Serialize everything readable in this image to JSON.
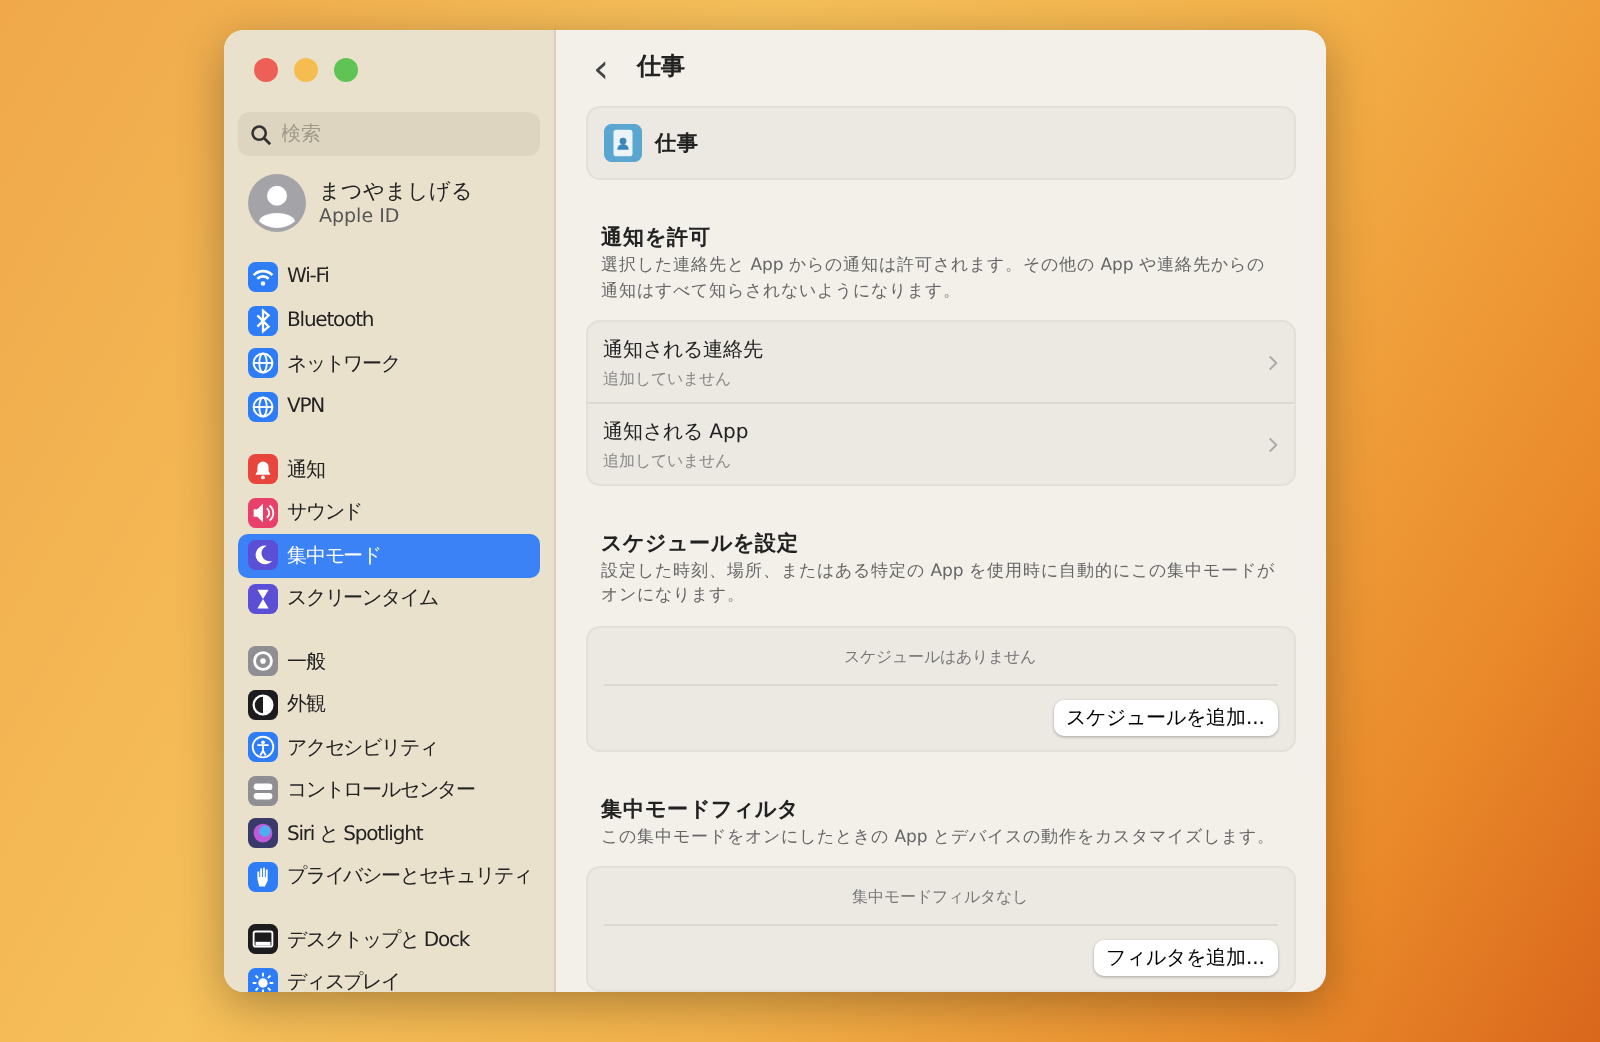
{
  "sidebar": {
    "search": {
      "placeholder": "検索"
    },
    "account": {
      "name": "まつやましげる",
      "subtitle": "Apple ID"
    },
    "groups": [
      [
        {
          "label": "Wi-Fi",
          "kind": "wifi",
          "color": "#2f7df6",
          "selected": false
        },
        {
          "label": "Bluetooth",
          "kind": "bluetooth",
          "color": "#2f7df6",
          "selected": false
        },
        {
          "label": "ネットワーク",
          "kind": "globe",
          "color": "#2f7df6",
          "selected": false
        },
        {
          "label": "VPN",
          "kind": "globe",
          "color": "#2f7df6",
          "selected": false
        }
      ],
      [
        {
          "label": "通知",
          "kind": "bell",
          "color": "#e8453c",
          "selected": false
        },
        {
          "label": "サウンド",
          "kind": "speaker",
          "color": "#e8406a",
          "selected": false
        },
        {
          "label": "集中モード",
          "kind": "moon",
          "color": "#5b4fd6",
          "selected": true
        },
        {
          "label": "スクリーンタイム",
          "kind": "hourglass",
          "color": "#5b4fd6",
          "selected": false
        }
      ],
      [
        {
          "label": "一般",
          "kind": "gear",
          "color": "#8e8e93",
          "selected": false
        },
        {
          "label": "外観",
          "kind": "contrast",
          "color": "#1c1c1e",
          "selected": false
        },
        {
          "label": "アクセシビリティ",
          "kind": "person",
          "color": "#2f7df6",
          "selected": false
        },
        {
          "label": "コントロールセンター",
          "kind": "toggles",
          "color": "#8e8e93",
          "selected": false
        },
        {
          "label": "Siri と Spotlight",
          "kind": "orb",
          "color": "#3a3a6a",
          "selected": false
        },
        {
          "label": "プライバシーとセキュリティ",
          "kind": "hand",
          "color": "#2f7df6",
          "selected": false
        }
      ],
      [
        {
          "label": "デスクトップと Dock",
          "kind": "dock",
          "color": "#1c1c1e",
          "selected": false
        },
        {
          "label": "ディスプレイ",
          "kind": "sun",
          "color": "#2f7df6",
          "selected": false
        }
      ]
    ]
  },
  "header": {
    "back": "‹",
    "title": "仕事"
  },
  "focus_card": {
    "name": "仕事"
  },
  "notifications": {
    "title": "通知を許可",
    "description": "選択した連絡先と App からの通知は許可されます。その他の App や連絡先からの通知はすべて知らされないようになります。",
    "rows": [
      {
        "title": "通知される連絡先",
        "subtitle": "追加していません"
      },
      {
        "title": "通知される App",
        "subtitle": "追加していません"
      }
    ]
  },
  "sections": [
    {
      "title": "スケジュールを設定",
      "description": "設定した時刻、場所、またはある特定の App を使用時に自動的にこの集中モードがオンになります。",
      "empty": "スケジュールはありません",
      "button": "スケジュールを追加..."
    },
    {
      "title": "集中モードフィルタ",
      "description": "この集中モードをオンにしたときの App とデバイスの動作をカスタマイズします。",
      "empty": "集中モードフィルタなし",
      "button": "フィルタを追加..."
    }
  ]
}
